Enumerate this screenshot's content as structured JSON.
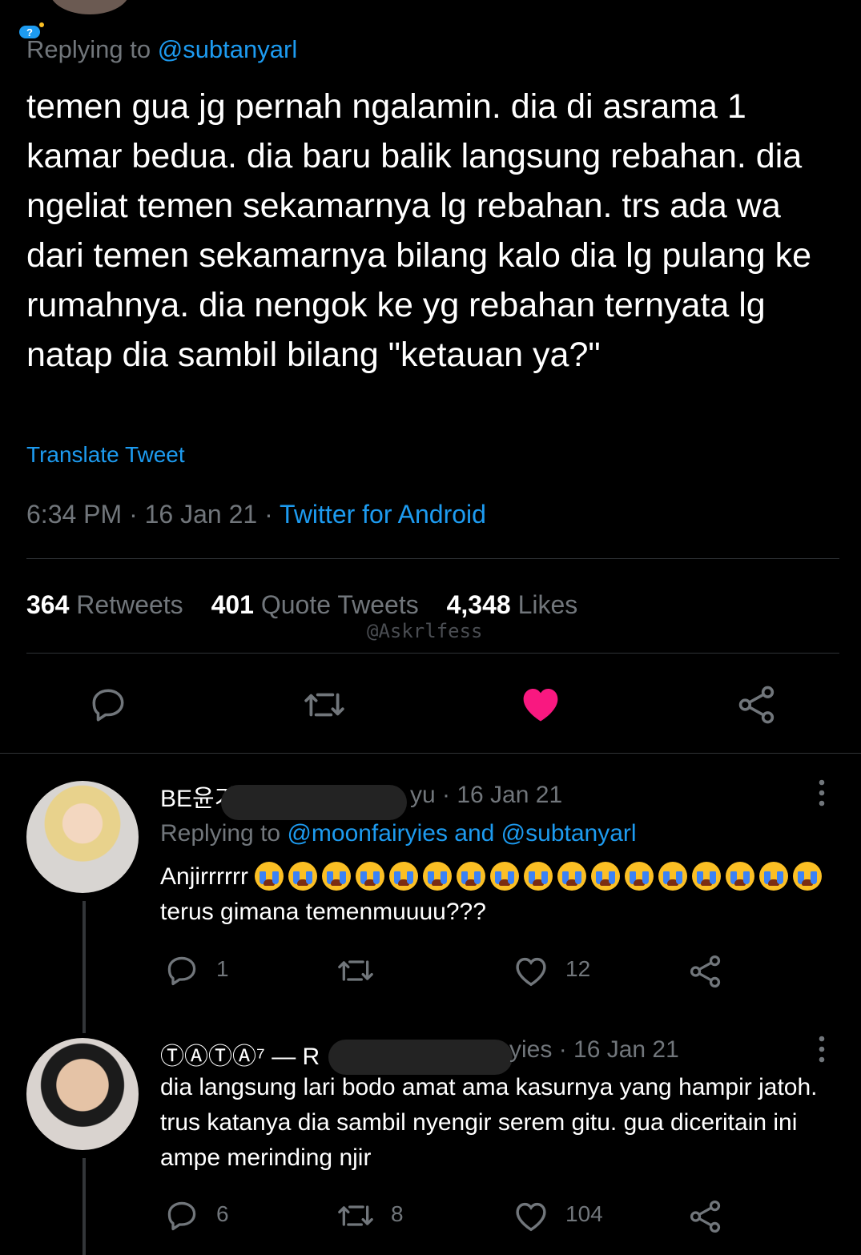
{
  "tweet": {
    "replying_prefix": "Replying to",
    "replying_handle": "@subtanyarl",
    "text": "temen gua jg pernah ngalamin. dia di asrama 1 kamar bedua. dia baru balik langsung rebahan. dia ngeliat temen sekamarnya lg rebahan. trs ada wa dari temen sekamarnya bilang kalo dia lg pulang ke rumahnya. dia nengok ke yg rebahan ternyata lg natap dia sambil bilang \"ketauan ya?\"",
    "translate_label": "Translate Tweet",
    "time": "6:34 PM",
    "date": "16 Jan 21",
    "source": "Twitter for Android",
    "retweets_count": "364",
    "retweets_label": "Retweets",
    "quotes_count": "401",
    "quotes_label": "Quote Tweets",
    "likes_count": "4,348",
    "likes_label": "Likes",
    "watermark": "@Askrlfess"
  },
  "replies": [
    {
      "name": "BE윤기",
      "handle_tail": "yu",
      "date": "· 16 Jan 21",
      "replying_prefix": "Replying to",
      "replying_handles": "@moonfairyies and @subtanyarl",
      "text_start": "Anjirrrrrr",
      "text_end": "terus gimana temenmuuuu???",
      "emoji_count": 17,
      "replies_count": "1",
      "retweets_count": "",
      "likes_count": "12"
    },
    {
      "name": "ⓉⒶⓉⒶ⁷ — R",
      "handle_tail": "yies",
      "date": "· 16 Jan 21",
      "text": "dia langsung lari bodo amat ama kasurnya yang hampir jatoh. trus katanya dia sambil nyengir serem gitu. gua diceritain ini ampe merinding njir",
      "replies_count": "6",
      "retweets_count": "8",
      "likes_count": "104"
    }
  ],
  "colors": {
    "accent": "#1d9bf0",
    "like": "#f91880",
    "background": "#000000"
  }
}
